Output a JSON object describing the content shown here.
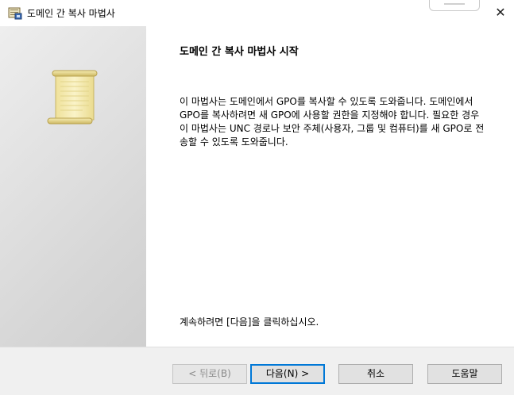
{
  "window": {
    "title": "도메인 간 복사 마법사",
    "close_glyph": "✕"
  },
  "content": {
    "heading": "도메인 간 복사 마법사 시작",
    "description": "이 마법사는 도메인에서 GPO를 복사할 수 있도록 도와줍니다. 도메인에서 GPO를 복사하려면 새 GPO에 사용할 권한을 지정해야 합니다. 필요한 경우 이 마법사는 UNC 경로나 보안 주체(사용자, 그룹 및 컴퓨터)를 새 GPO로 전송할 수 있도록 도와줍니다.",
    "continue_text": "계속하려면 [다음]을 클릭하십시오."
  },
  "buttons": {
    "back_label": "< 뒤로(B)",
    "next_label": "다음(N) >",
    "cancel_label": "취소",
    "help_label": "도움말"
  },
  "colors": {
    "default_button_border": "#0078d7",
    "button_face": "#e1e1e1",
    "button_bar": "#f0f0f0",
    "side_panel": "#dcdcdc",
    "scroll_parchment": "#f5ecb0"
  },
  "icons": {
    "title": "wizard-scroll-icon",
    "side": "scroll-icon",
    "close": "close-icon"
  }
}
